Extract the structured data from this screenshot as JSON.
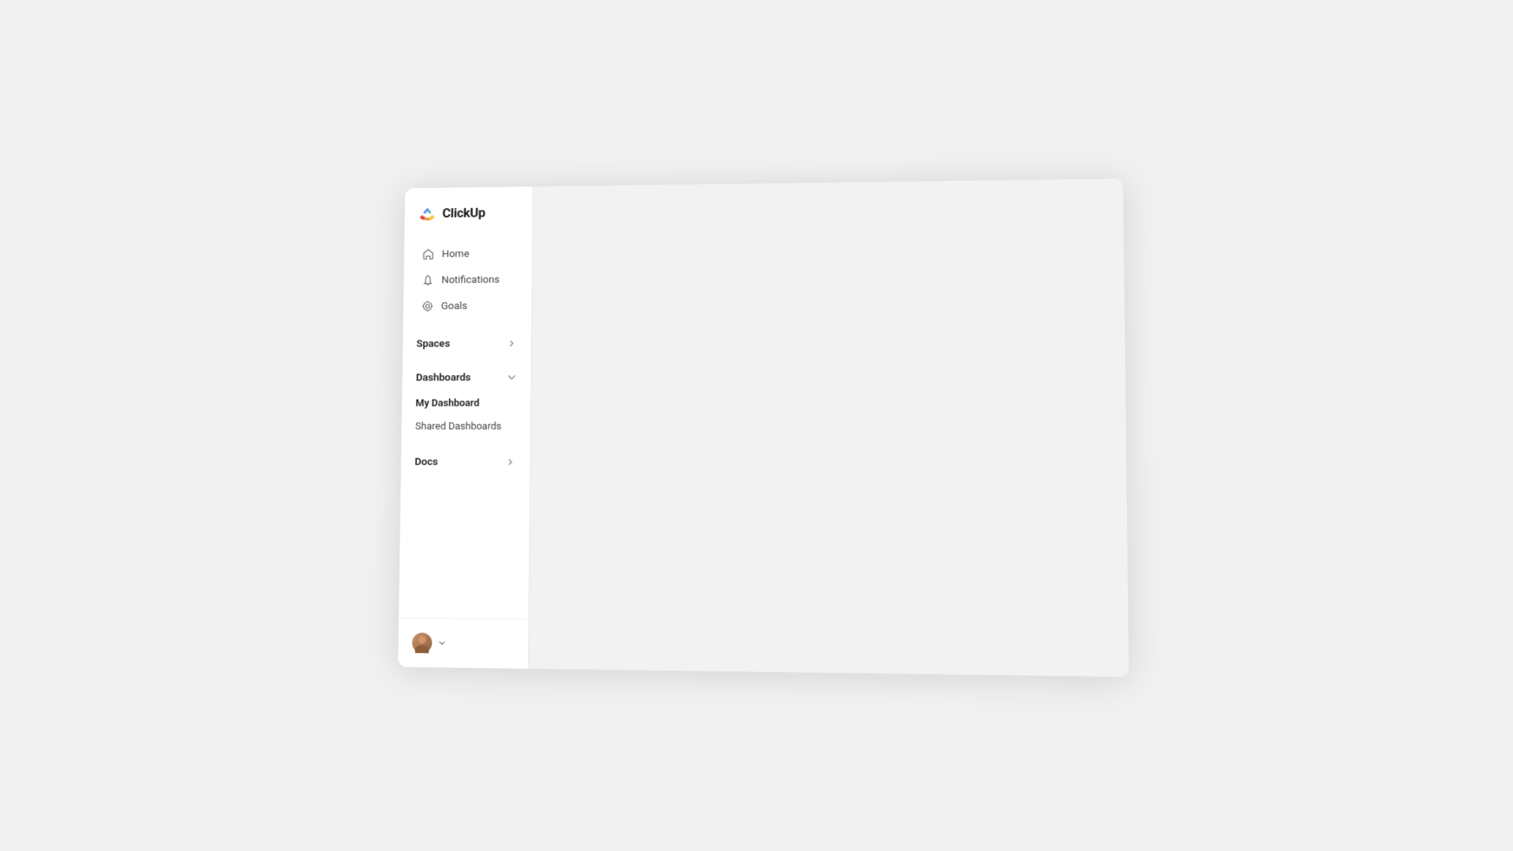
{
  "app": {
    "logo_text": "ClickUp"
  },
  "sidebar": {
    "nav_items": [
      {
        "id": "home",
        "label": "Home",
        "icon": "home-icon"
      },
      {
        "id": "notifications",
        "label": "Notifications",
        "icon": "bell-icon"
      },
      {
        "id": "goals",
        "label": "Goals",
        "icon": "goals-icon"
      }
    ],
    "sections": [
      {
        "id": "spaces",
        "title": "Spaces",
        "expanded": false,
        "chevron": "›",
        "items": []
      },
      {
        "id": "dashboards",
        "title": "Dashboards",
        "expanded": true,
        "chevron": "∨",
        "items": [
          {
            "id": "my-dashboard",
            "label": "My Dashboard",
            "active": true
          },
          {
            "id": "shared-dashboards",
            "label": "Shared Dashboards",
            "active": false
          }
        ]
      },
      {
        "id": "docs",
        "title": "Docs",
        "expanded": false,
        "chevron": "›",
        "items": []
      }
    ],
    "user": {
      "chevron": "∨"
    }
  }
}
